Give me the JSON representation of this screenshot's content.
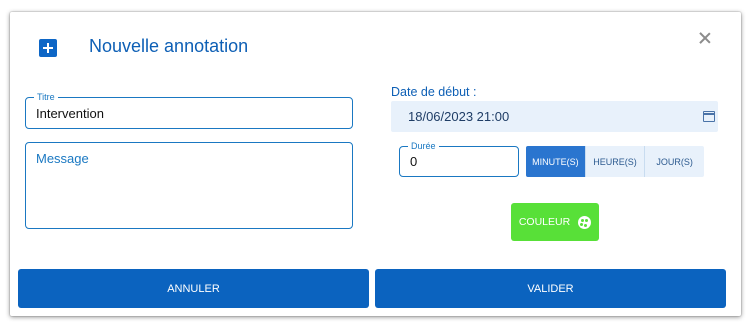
{
  "dialog": {
    "title": "Nouvelle annotation",
    "title_icon": "plus-square-icon",
    "close_icon": "close-icon"
  },
  "form": {
    "titre": {
      "legend": "Titre",
      "value": "Intervention"
    },
    "message": {
      "placeholder": "Message",
      "value": ""
    },
    "date_debut": {
      "label": "Date de début :",
      "value": "18/06/2023 21:00",
      "icon": "calendar-icon"
    },
    "duree": {
      "legend": "Durée",
      "value": "0"
    },
    "units": [
      {
        "label": "MINUTE(S)",
        "active": true
      },
      {
        "label": "HEURE(S)",
        "active": false
      },
      {
        "label": "JOUR(S)",
        "active": false
      }
    ],
    "couleur": {
      "label": "COULEUR",
      "color": "#58e038",
      "icon": "palette-icon"
    }
  },
  "actions": {
    "cancel_label": "ANNULER",
    "submit_label": "VALIDER"
  },
  "colors": {
    "primary": "#0b63bf",
    "accent": "#1a78c2",
    "selected_color": "#58e038"
  }
}
